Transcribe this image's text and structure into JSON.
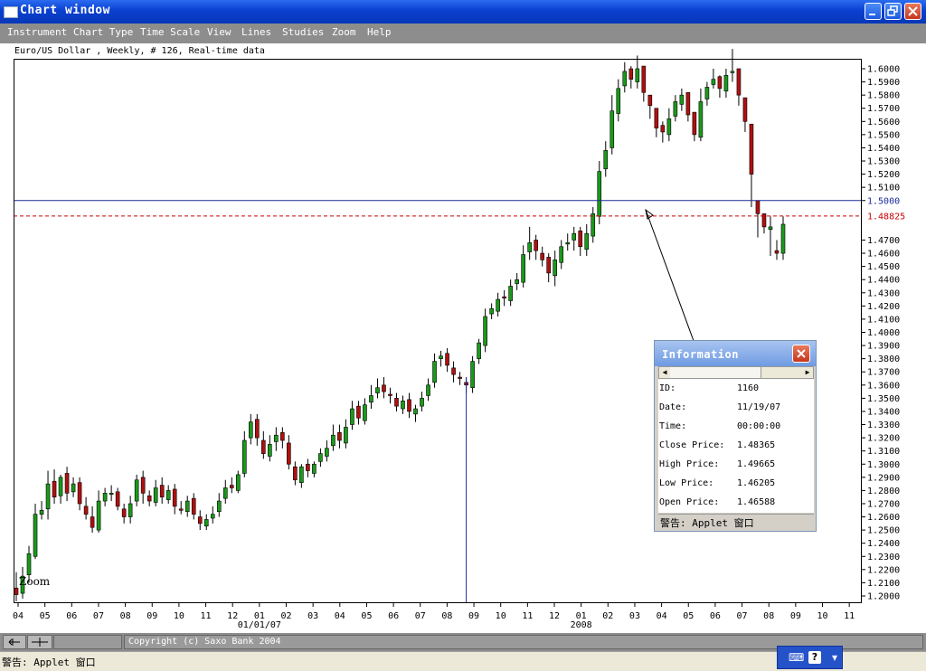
{
  "window": {
    "title": "Chart window"
  },
  "menu": [
    "Instrument",
    "Chart Type",
    "Time Scale",
    "View",
    "Lines",
    "Studies",
    "Zoom",
    "Help"
  ],
  "chart_header": "Euro/US Dollar , Weekly, # 126, Real-time data",
  "zoom_label": "Zoom",
  "chart_data": {
    "type": "candlestick",
    "y_axis_ticks": [
      "1.6000",
      "1.5900",
      "1.5800",
      "1.5700",
      "1.5600",
      "1.5500",
      "1.5400",
      "1.5300",
      "1.5200",
      "1.5100",
      "1.5000",
      "1.4700",
      "1.4600",
      "1.4500",
      "1.4400",
      "1.4300",
      "1.4200",
      "1.4100",
      "1.4000",
      "1.3900",
      "1.3800",
      "1.3700",
      "1.3600",
      "1.3500",
      "1.3400",
      "1.3300",
      "1.3200",
      "1.3100",
      "1.3000",
      "1.2900",
      "1.2800",
      "1.2700",
      "1.2600",
      "1.2500",
      "1.2400",
      "1.2300",
      "1.2200",
      "1.2100",
      "1.2000"
    ],
    "ylim": [
      1.2,
      1.6
    ],
    "x_axis_ticks": [
      "04",
      "05",
      "06",
      "07",
      "08",
      "09",
      "10",
      "11",
      "12",
      "01",
      "02",
      "03",
      "04",
      "05",
      "06",
      "07",
      "08",
      "09",
      "10",
      "11",
      "12",
      "01",
      "02",
      "03",
      "04",
      "05",
      "06",
      "07",
      "08",
      "09",
      "10",
      "11"
    ],
    "x_year_labels": [
      {
        "after_tick": 9,
        "label": "01/01/07"
      },
      {
        "after_tick": 21,
        "label": "2008"
      }
    ],
    "horizontal_line": 1.5,
    "price_marker": {
      "label": "1.48825",
      "value": 1.48825,
      "color": "#cc0000"
    },
    "crosshair_index": 71,
    "up_color": "#1a9a1a",
    "down_color": "#b01010",
    "close": [
      1.201,
      1.215,
      1.232,
      1.262,
      1.265,
      1.285,
      1.275,
      1.29,
      1.278,
      1.285,
      1.27,
      1.262,
      1.252,
      1.272,
      1.278,
      1.278,
      1.268,
      1.26,
      1.27,
      1.288,
      1.278,
      1.272,
      1.282,
      1.275,
      1.28,
      1.268,
      1.265,
      1.272,
      1.262,
      1.255,
      1.258,
      1.262,
      1.272,
      1.282,
      1.282,
      1.292,
      1.318,
      1.332,
      1.32,
      1.308,
      1.315,
      1.322,
      1.318,
      1.3,
      1.288,
      1.298,
      1.295,
      1.3,
      1.308,
      1.312,
      1.322,
      1.318,
      1.328,
      1.342,
      1.335,
      1.345,
      1.352,
      1.358,
      1.355,
      1.352,
      1.344,
      1.348,
      1.34,
      1.342,
      1.35,
      1.36,
      1.378,
      1.382,
      1.375,
      1.368,
      1.365,
      1.36,
      1.378,
      1.392,
      1.412,
      1.418,
      1.425,
      1.426,
      1.435,
      1.44,
      1.459,
      1.468,
      1.462,
      1.455,
      1.445,
      1.455,
      1.465,
      1.468,
      1.475,
      1.465,
      1.475,
      1.49,
      1.522,
      1.538,
      1.568,
      1.585,
      1.598,
      1.592,
      1.6,
      1.582,
      1.572,
      1.555,
      1.552,
      1.562,
      1.575,
      1.58,
      1.565,
      1.55,
      1.575,
      1.586,
      1.592,
      1.585,
      1.595,
      1.598,
      1.58,
      1.56,
      1.52,
      1.49,
      1.48,
      1.48,
      1.46,
      1.482
    ],
    "open": [
      1.206,
      1.202,
      1.216,
      1.23,
      1.262,
      1.266,
      1.287,
      1.276,
      1.293,
      1.279,
      1.286,
      1.268,
      1.26,
      1.25,
      1.272,
      1.278,
      1.279,
      1.266,
      1.26,
      1.272,
      1.29,
      1.276,
      1.271,
      1.284,
      1.273,
      1.281,
      1.266,
      1.264,
      1.274,
      1.26,
      1.253,
      1.259,
      1.264,
      1.274,
      1.284,
      1.28,
      1.293,
      1.32,
      1.334,
      1.318,
      1.306,
      1.317,
      1.324,
      1.316,
      1.298,
      1.286,
      1.3,
      1.293,
      1.302,
      1.306,
      1.314,
      1.324,
      1.316,
      1.33,
      1.344,
      1.333,
      1.347,
      1.354,
      1.36,
      1.353,
      1.35,
      1.342,
      1.349,
      1.338,
      1.344,
      1.352,
      1.362,
      1.38,
      1.384,
      1.373,
      1.366,
      1.362,
      1.358,
      1.38,
      1.39,
      1.414,
      1.416,
      1.427,
      1.424,
      1.437,
      1.438,
      1.461,
      1.47,
      1.46,
      1.457,
      1.443,
      1.453,
      1.467,
      1.47,
      1.477,
      1.463,
      1.473,
      1.488,
      1.524,
      1.54,
      1.566,
      1.587,
      1.6,
      1.59,
      1.602,
      1.58,
      1.57,
      1.557,
      1.55,
      1.564,
      1.573,
      1.582,
      1.567,
      1.548,
      1.577,
      1.588,
      1.594,
      1.583,
      1.597,
      1.6,
      1.578,
      1.558,
      1.5,
      1.49,
      1.478,
      1.462,
      1.46
    ],
    "high": [
      1.218,
      1.222,
      1.238,
      1.27,
      1.272,
      1.295,
      1.296,
      1.292,
      1.298,
      1.29,
      1.29,
      1.275,
      1.268,
      1.28,
      1.282,
      1.284,
      1.282,
      1.27,
      1.276,
      1.292,
      1.295,
      1.28,
      1.288,
      1.29,
      1.284,
      1.285,
      1.272,
      1.276,
      1.278,
      1.265,
      1.262,
      1.268,
      1.278,
      1.288,
      1.29,
      1.295,
      1.325,
      1.338,
      1.338,
      1.325,
      1.322,
      1.328,
      1.328,
      1.322,
      1.302,
      1.3,
      1.304,
      1.302,
      1.312,
      1.318,
      1.33,
      1.33,
      1.334,
      1.348,
      1.348,
      1.35,
      1.36,
      1.365,
      1.366,
      1.358,
      1.354,
      1.352,
      1.354,
      1.345,
      1.355,
      1.365,
      1.384,
      1.386,
      1.388,
      1.378,
      1.37,
      1.366,
      1.382,
      1.395,
      1.418,
      1.422,
      1.43,
      1.432,
      1.44,
      1.445,
      1.466,
      1.48,
      1.474,
      1.465,
      1.46,
      1.462,
      1.47,
      1.475,
      1.48,
      1.48,
      1.482,
      1.495,
      1.53,
      1.545,
      1.58,
      1.592,
      1.605,
      1.602,
      1.61,
      1.592,
      1.58,
      1.565,
      1.56,
      1.57,
      1.58,
      1.585,
      1.575,
      1.562,
      1.585,
      1.59,
      1.6,
      1.595,
      1.6,
      1.615,
      1.588,
      1.57,
      1.525,
      1.492,
      1.485,
      1.488,
      1.47,
      1.488
    ],
    "low": [
      1.196,
      1.198,
      1.21,
      1.228,
      1.258,
      1.258,
      1.27,
      1.27,
      1.272,
      1.275,
      1.265,
      1.258,
      1.248,
      1.248,
      1.268,
      1.272,
      1.265,
      1.255,
      1.255,
      1.268,
      1.27,
      1.268,
      1.268,
      1.27,
      1.27,
      1.262,
      1.262,
      1.26,
      1.258,
      1.25,
      1.25,
      1.255,
      1.26,
      1.27,
      1.278,
      1.278,
      1.29,
      1.315,
      1.314,
      1.304,
      1.302,
      1.31,
      1.312,
      1.296,
      1.284,
      1.282,
      1.29,
      1.29,
      1.298,
      1.302,
      1.31,
      1.312,
      1.312,
      1.326,
      1.33,
      1.33,
      1.342,
      1.35,
      1.35,
      1.346,
      1.34,
      1.338,
      1.335,
      1.332,
      1.34,
      1.348,
      1.358,
      1.374,
      1.37,
      1.362,
      1.36,
      1.354,
      1.354,
      1.376,
      1.385,
      1.41,
      1.412,
      1.42,
      1.42,
      1.432,
      1.434,
      1.455,
      1.455,
      1.45,
      1.438,
      1.435,
      1.448,
      1.462,
      1.462,
      1.458,
      1.458,
      1.468,
      1.482,
      1.518,
      1.535,
      1.56,
      1.582,
      1.585,
      1.585,
      1.575,
      1.562,
      1.548,
      1.544,
      1.545,
      1.56,
      1.568,
      1.56,
      1.545,
      1.545,
      1.572,
      1.585,
      1.578,
      1.578,
      1.59,
      1.572,
      1.552,
      1.495,
      1.472,
      1.475,
      1.458,
      1.455,
      1.455
    ]
  },
  "info_panel": {
    "title": "Information",
    "rows": [
      {
        "label": "ID:",
        "value": "1160"
      },
      {
        "label": "Date:",
        "value": "11/19/07"
      },
      {
        "label": "Time:",
        "value": "00:00:00"
      },
      {
        "label": "Close Price:",
        "value": "1.48365"
      },
      {
        "label": "High Price:",
        "value": "1.49665"
      },
      {
        "label": "Low Price:",
        "value": "1.46205"
      },
      {
        "label": "Open Price:",
        "value": "1.46588"
      }
    ],
    "warning": "警告: Applet 窗口"
  },
  "bottom": {
    "copyright": "Copyright (c) Saxo Bank 2004"
  },
  "status": {
    "warning": "警告: Applet 窗口"
  }
}
